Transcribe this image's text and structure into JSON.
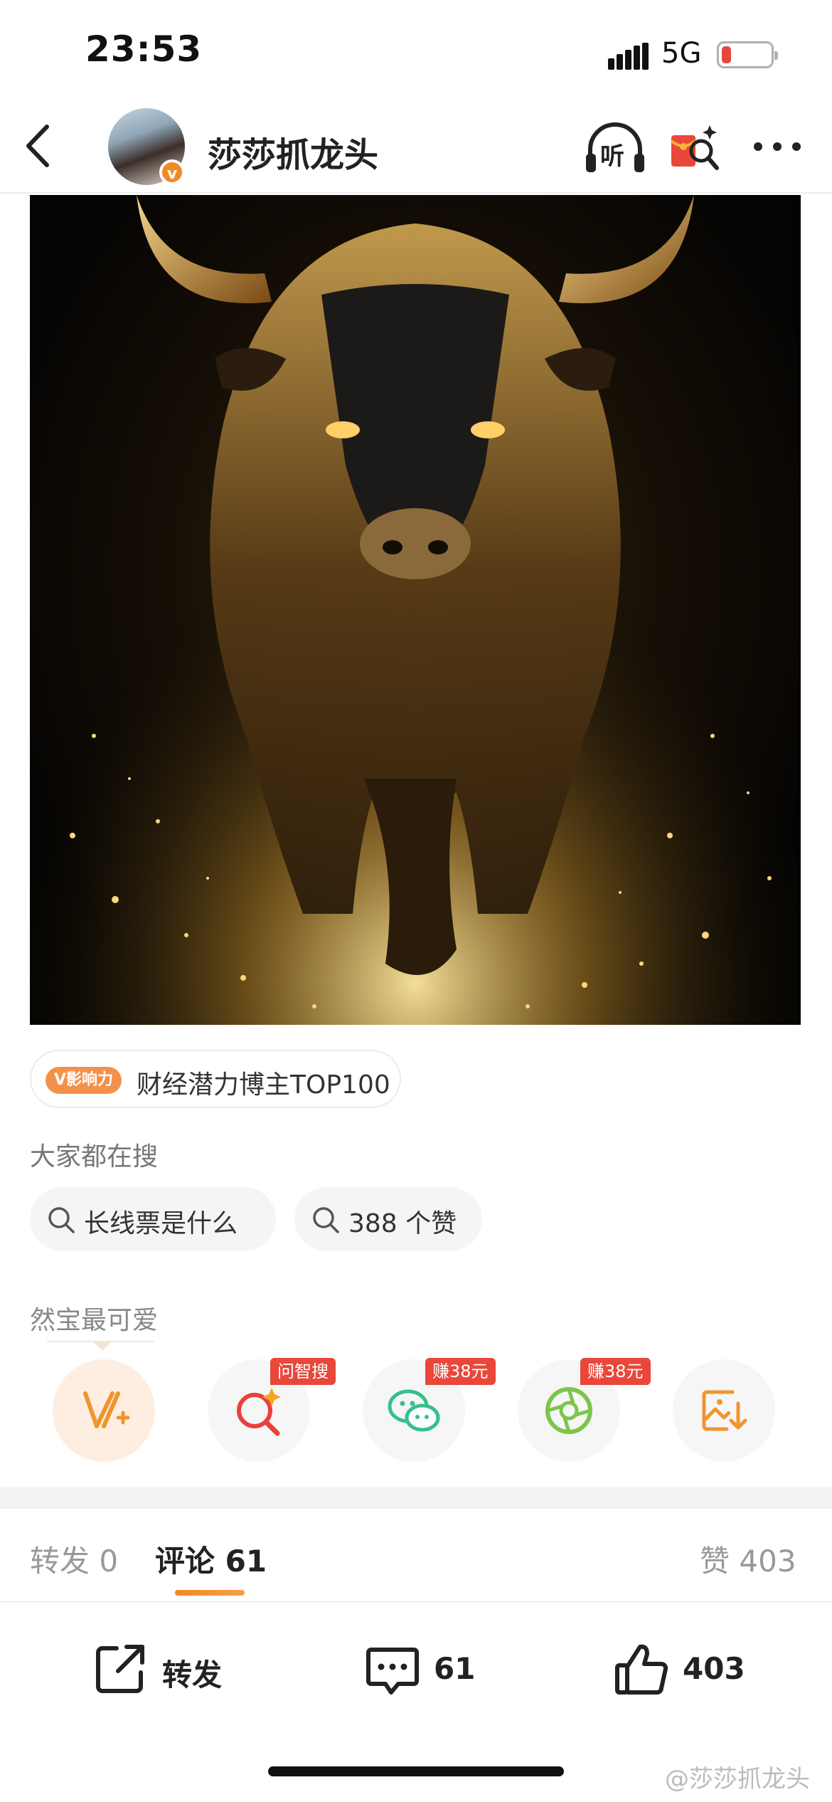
{
  "status_bar": {
    "time": "23:53",
    "network": "5G",
    "battery_level": 0.2,
    "battery_color": "#e8453c"
  },
  "header": {
    "title": "莎莎抓龙头",
    "verified_badge": "v",
    "listen_label": "听"
  },
  "badge": {
    "tag": "V影响力",
    "text": "财经潜力博主TOP100"
  },
  "search": {
    "label": "大家都在搜",
    "chips": [
      "长线票是什么",
      "388 个赞"
    ]
  },
  "share": {
    "title": "然宝最可爱",
    "tags": [
      "问智搜",
      "赚38元",
      "赚38元"
    ]
  },
  "tabs": [
    {
      "label": "转发",
      "count": "0"
    },
    {
      "label": "评论",
      "count": "61"
    },
    {
      "label": "赞",
      "count": "403"
    }
  ],
  "actions": {
    "repost_label": "转发",
    "comment_count": "61",
    "like_count": "403"
  },
  "watermark": "@莎莎抓龙头",
  "colors": {
    "accent": "#f08a24",
    "tag_red": "#e8473a"
  }
}
